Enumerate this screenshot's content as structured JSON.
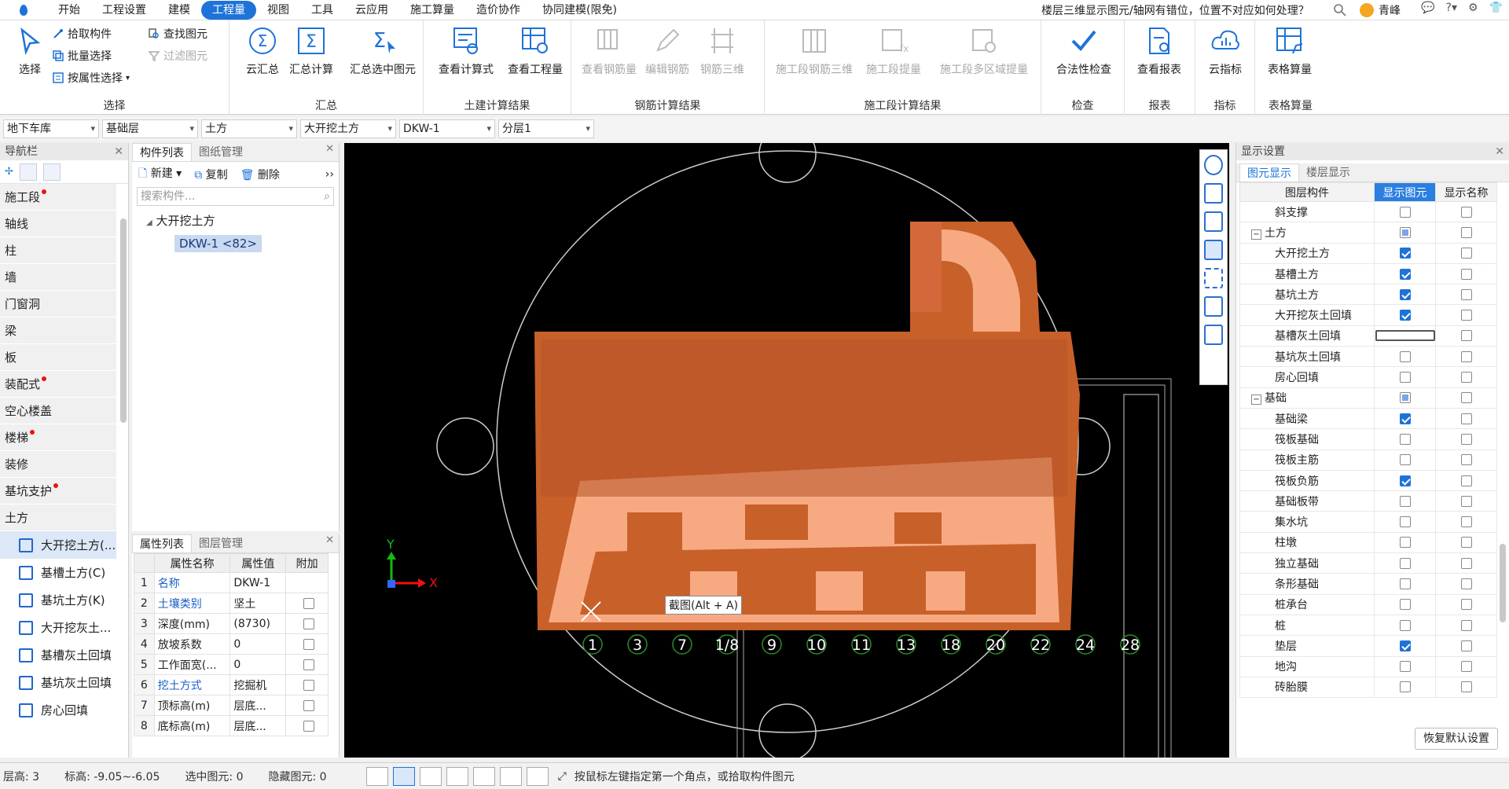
{
  "menu": {
    "items": [
      "开始",
      "工程设置",
      "建模",
      "工程量",
      "视图",
      "工具",
      "云应用",
      "施工算量",
      "造价协作",
      "协同建模(限免)"
    ],
    "active_index": 3
  },
  "help_search": "楼层三维显示图元/轴网有错位，位置不对应如何处理？",
  "user": {
    "name": "青峰"
  },
  "ribbon": {
    "select": {
      "big": "选择",
      "pick": "拾取构件",
      "batch": "批量选择",
      "by_attr": "按属性选择",
      "find": "查找图元",
      "filter": "过滤图元",
      "label": "选择"
    },
    "summary": {
      "cloud": "云汇总",
      "calc": "汇总计算",
      "calc_sel": "汇总选中图元",
      "label": "汇总"
    },
    "civil": {
      "formula": "查看计算式",
      "qty": "查看工程量",
      "label": "土建计算结果"
    },
    "rebar": {
      "view": "查看钢筋量",
      "edit": "编辑钢筋",
      "r3d": "钢筋三维",
      "label": "钢筋计算结果"
    },
    "stage": {
      "s3d": "施工段钢筋三维",
      "sqty": "施工段提量",
      "smulti": "施工段多区域提量",
      "label": "施工段计算结果"
    },
    "check": {
      "legal": "合法性检查",
      "label": "检查"
    },
    "report": {
      "view": "查看报表",
      "label": "报表"
    },
    "index": {
      "cloud": "云指标",
      "label": "指标"
    },
    "table": {
      "calc": "表格算量",
      "label": "表格算量"
    }
  },
  "selectors": [
    "地下车库",
    "基础层",
    "土方",
    "大开挖土方",
    "DKW-1",
    "分层1"
  ],
  "nav": {
    "title": "导航栏",
    "categories": [
      {
        "label": "施工段",
        "dot": true
      },
      {
        "label": "轴线",
        "dot": false
      },
      {
        "label": "柱",
        "dot": false
      },
      {
        "label": "墙",
        "dot": false
      },
      {
        "label": "门窗洞",
        "dot": false
      },
      {
        "label": "梁",
        "dot": false
      },
      {
        "label": "板",
        "dot": false
      },
      {
        "label": "装配式",
        "dot": true
      },
      {
        "label": "空心楼盖",
        "dot": false
      },
      {
        "label": "楼梯",
        "dot": true
      },
      {
        "label": "装修",
        "dot": false
      },
      {
        "label": "基坑支护",
        "dot": true
      },
      {
        "label": "土方",
        "dot": false
      }
    ],
    "sub_items": [
      "大开挖土方(...",
      "基槽土方(C)",
      "基坑土方(K)",
      "大开挖灰土...",
      "基槽灰土回填",
      "基坑灰土回填",
      "房心回填"
    ]
  },
  "components": {
    "tabs": [
      "构件列表",
      "图纸管理"
    ],
    "new": "新建",
    "copy": "复制",
    "delete": "删除",
    "search_placeholder": "搜索构件...",
    "root": "大开挖土方",
    "leaf": "DKW-1 <82>"
  },
  "props": {
    "tabs": [
      "属性列表",
      "图层管理"
    ],
    "headers": [
      "属性名称",
      "属性值",
      "附加"
    ],
    "rows": [
      {
        "n": "1",
        "name": "名称",
        "value": "DKW-1",
        "link": true,
        "check": false
      },
      {
        "n": "2",
        "name": "土壤类别",
        "value": "坚土",
        "link": true,
        "check": true
      },
      {
        "n": "3",
        "name": "深度(mm)",
        "value": "(8730)",
        "link": false,
        "check": true
      },
      {
        "n": "4",
        "name": "放坡系数",
        "value": "0",
        "link": false,
        "check": true
      },
      {
        "n": "5",
        "name": "工作面宽(...",
        "value": "0",
        "link": false,
        "check": true
      },
      {
        "n": "6",
        "name": "挖土方式",
        "value": "挖掘机",
        "link": true,
        "check": true
      },
      {
        "n": "7",
        "name": "顶标高(m)",
        "value": "层底...",
        "link": false,
        "check": true
      },
      {
        "n": "8",
        "name": "底标高(m)",
        "value": "层底...",
        "link": false,
        "check": true
      }
    ]
  },
  "viewport": {
    "tooltip": "截图(Alt + A)",
    "axis_labels": [
      "1",
      "3",
      "7",
      "1/8",
      "9",
      "10",
      "11",
      "13",
      "18",
      "20",
      "22",
      "24",
      "28"
    ],
    "axis_x": "X",
    "axis_y": "Y",
    "colors": {
      "earth_dark": "#c8602a",
      "earth_light": "#f7a982",
      "background": "#000000"
    }
  },
  "display": {
    "title": "显示设置",
    "tabs": [
      "图元显示",
      "楼层显示"
    ],
    "headers": [
      "图层构件",
      "显示图元",
      "显示名称"
    ],
    "rows": [
      {
        "label": "斜支撑",
        "level": 2,
        "show": "off",
        "name": "off"
      },
      {
        "label": "土方",
        "level": 1,
        "show": "partial",
        "name": "off"
      },
      {
        "label": "大开挖土方",
        "level": 2,
        "show": "on",
        "name": "off"
      },
      {
        "label": "基槽土方",
        "level": 2,
        "show": "on",
        "name": "off"
      },
      {
        "label": "基坑土方",
        "level": 2,
        "show": "on",
        "name": "off"
      },
      {
        "label": "大开挖灰土回填",
        "level": 2,
        "show": "on",
        "name": "off"
      },
      {
        "label": "基槽灰土回填",
        "level": 2,
        "show": "focus",
        "name": "off"
      },
      {
        "label": "基坑灰土回填",
        "level": 2,
        "show": "off",
        "name": "off"
      },
      {
        "label": "房心回填",
        "level": 2,
        "show": "off",
        "name": "off"
      },
      {
        "label": "基础",
        "level": 1,
        "show": "partial",
        "name": "off"
      },
      {
        "label": "基础梁",
        "level": 2,
        "show": "on",
        "name": "off"
      },
      {
        "label": "筏板基础",
        "level": 2,
        "show": "off",
        "name": "off"
      },
      {
        "label": "筏板主筋",
        "level": 2,
        "show": "off",
        "name": "off"
      },
      {
        "label": "筏板负筋",
        "level": 2,
        "show": "on",
        "name": "off"
      },
      {
        "label": "基础板带",
        "level": 2,
        "show": "off",
        "name": "off"
      },
      {
        "label": "集水坑",
        "level": 2,
        "show": "off",
        "name": "off"
      },
      {
        "label": "柱墩",
        "level": 2,
        "show": "off",
        "name": "off"
      },
      {
        "label": "独立基础",
        "level": 2,
        "show": "off",
        "name": "off"
      },
      {
        "label": "条形基础",
        "level": 2,
        "show": "off",
        "name": "off"
      },
      {
        "label": "桩承台",
        "level": 2,
        "show": "off",
        "name": "off"
      },
      {
        "label": "桩",
        "level": 2,
        "show": "off",
        "name": "off"
      },
      {
        "label": "垫层",
        "level": 2,
        "show": "on",
        "name": "off"
      },
      {
        "label": "地沟",
        "level": 2,
        "show": "off",
        "name": "off"
      },
      {
        "label": "砖胎膜",
        "level": 2,
        "show": "off",
        "name": "off"
      }
    ],
    "restore": "恢复默认设置"
  },
  "status": {
    "floor_height": "层高:   3",
    "elevation": "标高:   -9.05~-6.05",
    "selected": "选中图元:  0",
    "hidden": "隐藏图元:  0",
    "hint": "按鼠标左键指定第一个角点，或拾取构件图元"
  }
}
